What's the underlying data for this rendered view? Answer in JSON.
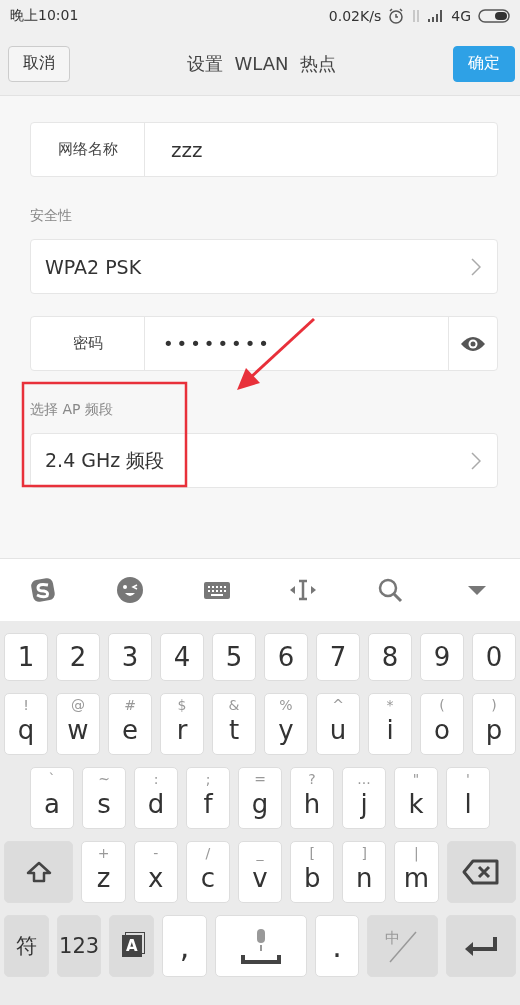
{
  "status_bar": {
    "time": "晚上10:01",
    "speed": "0.02K/s",
    "network": "4G"
  },
  "header": {
    "cancel": "取消",
    "title": "设置  WLAN  热点",
    "confirm": "确定"
  },
  "form": [
    {
      "kind": "labeled",
      "label": "网络名称",
      "value": "zzz"
    },
    {
      "kind": "section",
      "label": "安全性"
    },
    {
      "kind": "select",
      "value": "WPA2 PSK"
    },
    {
      "kind": "password",
      "label": "密码",
      "value": "••••••••"
    },
    {
      "kind": "section",
      "label": "选择 AP 频段"
    },
    {
      "kind": "select",
      "value": "2.4 GHz 频段"
    }
  ],
  "keyboard": {
    "rows": [
      [
        {
          "kind": "digit",
          "main": "1"
        },
        {
          "kind": "digit",
          "main": "2"
        },
        {
          "kind": "digit",
          "main": "3"
        },
        {
          "kind": "digit",
          "main": "4"
        },
        {
          "kind": "digit",
          "main": "5"
        },
        {
          "kind": "digit",
          "main": "6"
        },
        {
          "kind": "digit",
          "main": "7"
        },
        {
          "kind": "digit",
          "main": "8"
        },
        {
          "kind": "digit",
          "main": "9"
        },
        {
          "kind": "digit",
          "main": "0"
        }
      ],
      [
        {
          "kind": "letter",
          "alt": "!",
          "main": "q"
        },
        {
          "kind": "letter",
          "alt": "@",
          "main": "w"
        },
        {
          "kind": "letter",
          "alt": "#",
          "main": "e"
        },
        {
          "kind": "letter",
          "alt": "$",
          "main": "r"
        },
        {
          "kind": "letter",
          "alt": "&",
          "main": "t"
        },
        {
          "kind": "letter",
          "alt": "%",
          "main": "y"
        },
        {
          "kind": "letter",
          "alt": "^",
          "main": "u"
        },
        {
          "kind": "letter",
          "alt": "*",
          "main": "i"
        },
        {
          "kind": "letter",
          "alt": "(",
          "main": "o"
        },
        {
          "kind": "letter",
          "alt": ")",
          "main": "p"
        }
      ],
      [
        {
          "kind": "letter",
          "alt": "`",
          "main": "a"
        },
        {
          "kind": "letter",
          "alt": "~",
          "main": "s"
        },
        {
          "kind": "letter",
          "alt": ":",
          "main": "d"
        },
        {
          "kind": "letter",
          "alt": ";",
          "main": "f"
        },
        {
          "kind": "letter",
          "alt": "=",
          "main": "g"
        },
        {
          "kind": "letter",
          "alt": "?",
          "main": "h"
        },
        {
          "kind": "letter",
          "alt": "...",
          "main": "j"
        },
        {
          "kind": "letter",
          "alt": "\"",
          "main": "k"
        },
        {
          "kind": "letter",
          "alt": "'",
          "main": "l"
        }
      ],
      [
        {
          "kind": "shift"
        },
        {
          "kind": "letter",
          "alt": "+",
          "main": "z"
        },
        {
          "kind": "letter",
          "alt": "-",
          "main": "x"
        },
        {
          "kind": "letter",
          "alt": "/",
          "main": "c"
        },
        {
          "kind": "letter",
          "alt": "_",
          "main": "v"
        },
        {
          "kind": "letter",
          "alt": "[",
          "main": "b"
        },
        {
          "kind": "letter",
          "alt": "]",
          "main": "n"
        },
        {
          "kind": "letter",
          "alt": "|",
          "main": "m"
        },
        {
          "kind": "backspace"
        }
      ],
      [
        {
          "kind": "function",
          "main": "符"
        },
        {
          "kind": "function",
          "main": "123"
        },
        {
          "kind": "dict",
          "main": "A"
        },
        {
          "kind": "punct",
          "main": ","
        },
        {
          "kind": "space"
        },
        {
          "kind": "punct",
          "main": "."
        },
        {
          "kind": "lang",
          "main": "中"
        },
        {
          "kind": "enter"
        }
      ]
    ]
  }
}
